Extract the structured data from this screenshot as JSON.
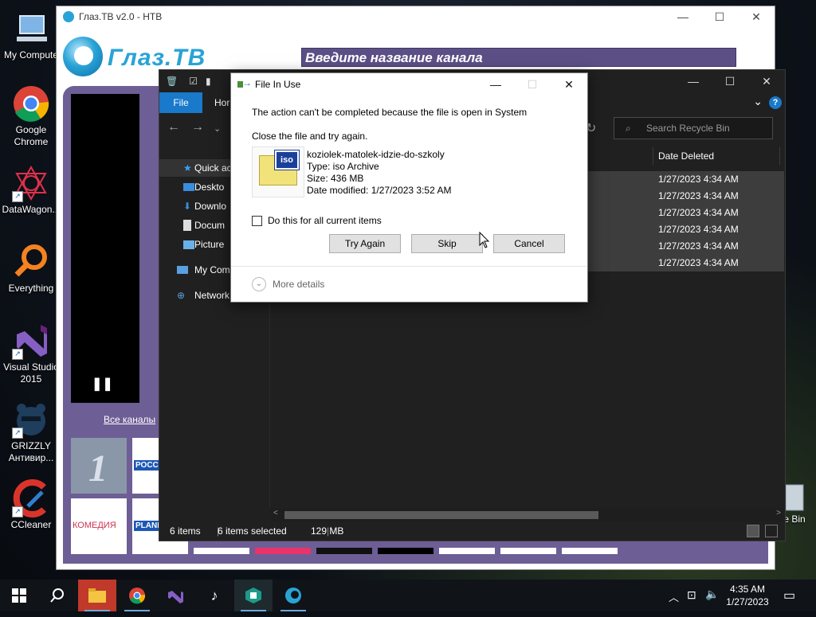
{
  "desktop": {
    "icons": [
      {
        "label": "My Compute",
        "icon": "computer-icon"
      },
      {
        "label": "Google Chrome",
        "icon": "chrome-icon"
      },
      {
        "label": "DataWagon...",
        "icon": "datawagon-icon"
      },
      {
        "label": "Everything",
        "icon": "everything-search-icon"
      },
      {
        "label": "Visual Studio 2015",
        "icon": "visual-studio-icon"
      },
      {
        "label": "GRIZZLY Антивир...",
        "icon": "grizzly-antivirus-icon"
      },
      {
        "label": "CCleaner",
        "icon": "ccleaner-icon"
      }
    ],
    "recycle_bin_label": "e Bin"
  },
  "glaz": {
    "title": "Глаз.ТВ v2.0 - НТВ",
    "logo_text": "Глаз.ТВ",
    "channel_input_placeholder": "Введите название канала",
    "all_channels_link": "Все каналы",
    "tiles": [
      "",
      "РОСС",
      "",
      "КОМЕДИЯ",
      "PLANE"
    ],
    "accent": "#6d5e95"
  },
  "explorer": {
    "ribbon": {
      "file_tab": "File",
      "home_tab": "Hor"
    },
    "search_placeholder": "Search Recycle Bin",
    "sidebar": [
      {
        "label": "Quick ac",
        "icon": "star-icon"
      },
      {
        "label": "Deskto",
        "icon": "desktop-icon"
      },
      {
        "label": "Downlo",
        "icon": "download-icon"
      },
      {
        "label": "Docum",
        "icon": "documents-icon"
      },
      {
        "label": "Picture",
        "icon": "pictures-icon"
      },
      {
        "label": "My Com",
        "icon": "computer-icon"
      },
      {
        "label": "Network",
        "icon": "network-icon"
      }
    ],
    "column_header": "Date Deleted",
    "rows": [
      "1/27/2023 4:34 AM",
      "1/27/2023 4:34 AM",
      "1/27/2023 4:34 AM",
      "1/27/2023 4:34 AM",
      "1/27/2023 4:34 AM",
      "1/27/2023 4:34 AM"
    ],
    "status": {
      "items": "6 items",
      "selected": "6 items selected",
      "size": "129 MB"
    }
  },
  "dialog": {
    "title": "File In Use",
    "message": "The action can't be completed because the file is open in System",
    "instruction": "Close the file and try again.",
    "file": {
      "name": "koziolek-matolek-idzie-do-szkoly",
      "type": "Type: iso Archive",
      "size": "Size: 436 MB",
      "modified": "Date modified: 1/27/2023 3:52 AM",
      "badge": "iso"
    },
    "checkbox_label": "Do this for all current items",
    "buttons": {
      "try_again": "Try Again",
      "skip": "Skip",
      "cancel": "Cancel"
    },
    "more_details": "More details"
  },
  "taskbar": {
    "apps": [
      "start-icon",
      "search-icon",
      "file-explorer-icon",
      "chrome-icon",
      "visual-studio-icon",
      "tiktok-icon",
      "app-icon",
      "glaz-tv-icon"
    ],
    "time": "4:35 AM",
    "date": "1/27/2023"
  }
}
